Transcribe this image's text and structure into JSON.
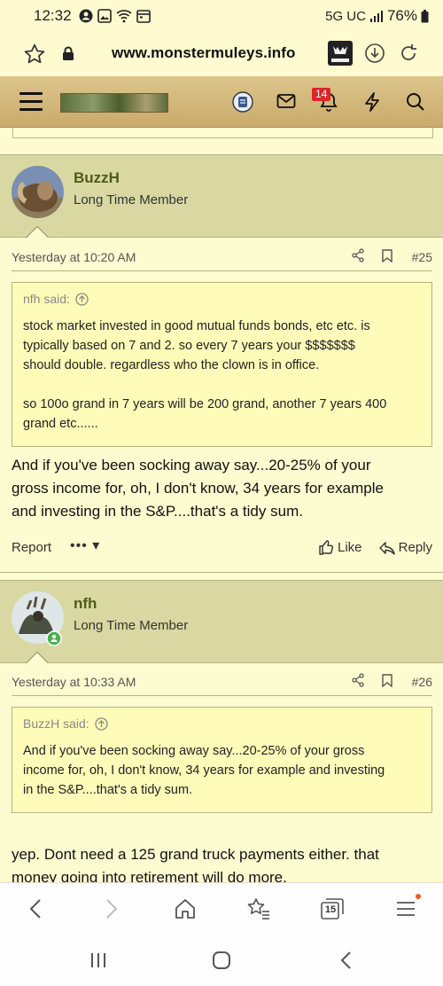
{
  "status": {
    "time": "12:32",
    "network": "5G UC",
    "battery": "76%"
  },
  "browser": {
    "url": "www.monstermuleys.info",
    "tab_count": "15"
  },
  "header": {
    "notification_count": "14"
  },
  "posts": [
    {
      "username": "BuzzH",
      "user_title": "Long Time Member",
      "date": "Yesterday at 10:20 AM",
      "number": "#25",
      "quote_author": "nfh said:",
      "quote_lines": [
        "stock market invested in good mutual funds bonds, etc etc. is",
        "typically based on 7 and 2. so every 7 years your $$$$$$$",
        "should double. regardless who the clown is in office.",
        "",
        "so 100o grand in 7 years will be 200 grand, another 7 years 400",
        "grand etc......"
      ],
      "text_lines": [
        "And if you've been socking away say...20-25% of your",
        "gross income for, oh, I don't know, 34 years for example",
        "and investing in the S&P....that's a tidy sum."
      ],
      "report_label": "Report",
      "more_label": "••• ▾",
      "like_label": "Like",
      "reply_label": "Reply"
    },
    {
      "username": "nfh",
      "user_title": "Long Time Member",
      "date": "Yesterday at 10:33 AM",
      "number": "#26",
      "quote_author": "BuzzH said:",
      "quote_lines": [
        "And if you've been socking away say...20-25% of your gross",
        "income for, oh, I don't know, 34 years for example and investing",
        "in the S&P....that's a tidy sum."
      ],
      "text_lines": [
        "yep. Dont need a 125 grand truck payments either. that",
        "money going into retirement will do more."
      ]
    }
  ],
  "colors": {
    "page_bg": "#fdfbd0",
    "header_bg": "#d9d8a2",
    "username": "#4f5b18",
    "quote_bg": "#fffcb9",
    "badge": "#d8282b"
  }
}
